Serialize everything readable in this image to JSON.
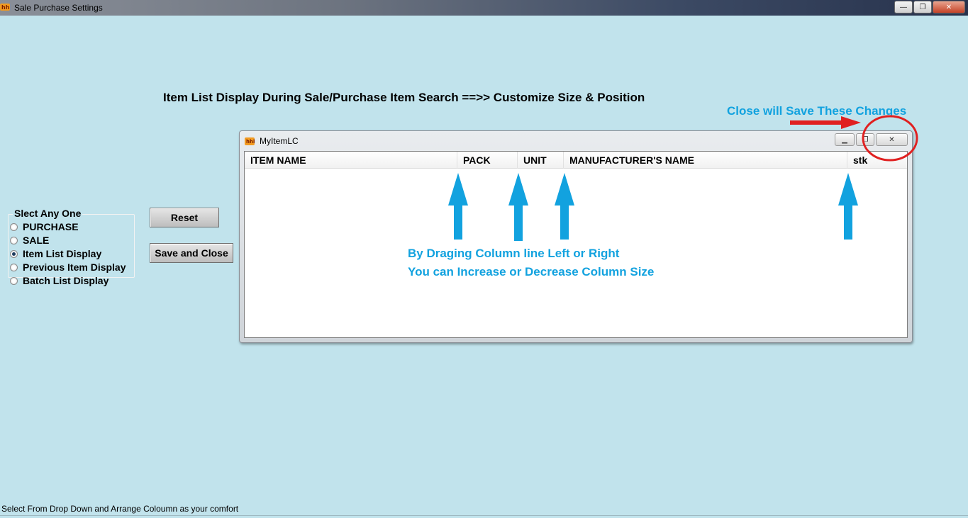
{
  "window": {
    "title": "Sale Purchase Settings",
    "minimize": "—",
    "restore": "❐",
    "close": "✕"
  },
  "heading": "Item List Display During Sale/Purchase Item Search ==>> Customize Size & Position",
  "annotations": {
    "close_note": "Close will Save These Changes",
    "drag_line1": "By Draging Column line Left or Right",
    "drag_line2": "You can Increase or Decrease Column Size"
  },
  "options": {
    "label": "Slect Any One",
    "items": [
      {
        "label": "PURCHASE",
        "checked": false
      },
      {
        "label": "SALE",
        "checked": false
      },
      {
        "label": "Item List Display",
        "checked": true
      },
      {
        "label": "Previous Item Display",
        "checked": false
      },
      {
        "label": "Batch List Display",
        "checked": false
      }
    ]
  },
  "buttons": {
    "reset": "Reset",
    "save_close": "Save and Close"
  },
  "inner_window": {
    "title": "MyItemLC",
    "minimize": "▁",
    "restore": "❐",
    "close": "✕",
    "columns": [
      "ITEM NAME",
      "PACK",
      "UNIT",
      "MANUFACTURER'S NAME",
      "stk"
    ]
  },
  "status_text": "Select From Drop Down and Arrange Coloumn as your comfort",
  "colors": {
    "background": "#c1e3ec",
    "annotation": "#12a2df",
    "arrow": "#12a2df",
    "highlight": "#e02020"
  }
}
